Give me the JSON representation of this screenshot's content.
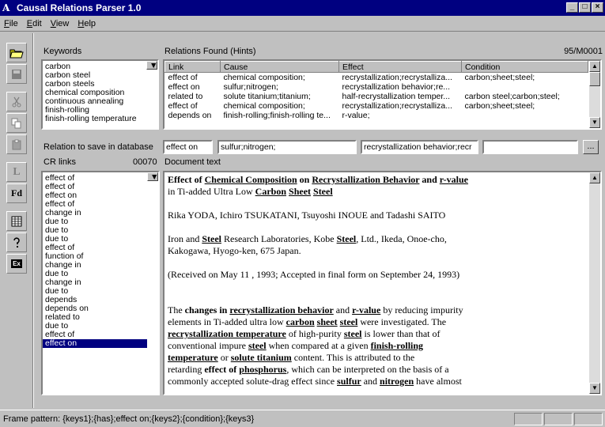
{
  "app": {
    "title": "Causal Relations Parser 1.0"
  },
  "menu": [
    {
      "pre": "",
      "u": "F",
      "post": "ile"
    },
    {
      "pre": "",
      "u": "E",
      "post": "dit"
    },
    {
      "pre": "",
      "u": "V",
      "post": "iew"
    },
    {
      "pre": "",
      "u": "H",
      "post": "elp"
    }
  ],
  "toolbar": {
    "l_label": "L",
    "fd_label": "Fd",
    "ex_label": "Ex",
    "help_label": "?"
  },
  "keywords": {
    "label": "Keywords",
    "items": [
      "carbon",
      "carbon steel",
      "carbon steels",
      "chemical composition",
      "continuous annealing",
      "finish-rolling",
      "finish-rolling temperature"
    ]
  },
  "relations": {
    "label": "Relations Found (Hints)",
    "counter": "95/M0001",
    "columns": [
      "Link",
      "Cause",
      "Effect",
      "Condition"
    ],
    "rows": [
      [
        "effect of",
        "chemical composition;",
        "recrystallization;recrystalliza...",
        "carbon;sheet;steel;"
      ],
      [
        "effect on",
        "sulfur;nitrogen;",
        "recrystallization behavior;re...",
        ""
      ],
      [
        "related to",
        "solute titanium;titanium;",
        "half-recrystallization temper...",
        "carbon steel;carbon;steel;"
      ],
      [
        "effect of",
        "chemical composition;",
        "recrystallization;recrystalliza...",
        "carbon;sheet;steel;"
      ],
      [
        "depends on",
        "finish-rolling;finish-rolling te...",
        "r-value;",
        ""
      ]
    ]
  },
  "save": {
    "label": "Relation to save in database",
    "link": "effect on",
    "cause": "sulfur;nitrogen;",
    "effect": "recrystallization behavior;recr",
    "condition": "",
    "browse": "..."
  },
  "crlinks": {
    "label": "CR links",
    "count": "00070",
    "items": [
      "effect of",
      "effect of",
      "effect on",
      "effect of",
      "change in",
      "due to",
      "due to",
      "due to",
      "effect of",
      "function of",
      "change in",
      "due to",
      "change in",
      "due to",
      "depends",
      "depends on",
      "related to",
      "due to",
      "effect of",
      "effect on"
    ],
    "selected_index": 19
  },
  "doc": {
    "label": "Document text",
    "title1": {
      "a": "Effect of ",
      "b": "Chemical Composition",
      "c": " on ",
      "d": "Recrystallization Behavior",
      "e": " and ",
      "f": "r-value"
    },
    "title2": {
      "a": "in Ti-added Ultra Low ",
      "b": "Carbon",
      "c": " ",
      "d": "Sheet",
      "e": " ",
      "f": "Steel"
    },
    "authors": "Rika YODA, Ichiro TSUKATANI, Tsuyoshi INOUE and Tadashi SAITO",
    "affil1": {
      "a": "Iron and ",
      "b": "Steel",
      "c": " Research Laboratories, Kobe ",
      "d": "Steel",
      "e": ", Ltd., Ikeda, Onoe-cho,"
    },
    "affil2": "Kakogawa, Hyogo-ken, 675 Japan.",
    "received": "(Received on May 11 , 1993; Accepted in final form on September 24, 1993)",
    "abs": [
      [
        {
          "t": "The "
        },
        {
          "t": "changes in",
          "c": "b"
        },
        {
          "t": " "
        },
        {
          "t": "recrystallization behavior",
          "c": "k"
        },
        {
          "t": " and "
        },
        {
          "t": "r-value",
          "c": "k"
        },
        {
          "t": " by reducing impurity"
        }
      ],
      [
        {
          "t": "elements in Ti-added ultra low "
        },
        {
          "t": "carbon",
          "c": "k"
        },
        {
          "t": " "
        },
        {
          "t": "sheet",
          "c": "k"
        },
        {
          "t": " "
        },
        {
          "t": "steel",
          "c": "k"
        },
        {
          "t": " were investigated. The"
        }
      ],
      [
        {
          "t": "recrystallization temperature",
          "c": "k"
        },
        {
          "t": " of high-purity "
        },
        {
          "t": "steel",
          "c": "k"
        },
        {
          "t": " is lower than that of"
        }
      ],
      [
        {
          "t": "conventional impure "
        },
        {
          "t": "steel",
          "c": "k"
        },
        {
          "t": " when compared at a given "
        },
        {
          "t": "finish-rolling",
          "c": "k"
        }
      ],
      [
        {
          "t": "temperature",
          "c": "k"
        },
        {
          "t": " or "
        },
        {
          "t": "solute titanium",
          "c": "k"
        },
        {
          "t": " content. This is attributed to the"
        }
      ],
      [
        {
          "t": "retarding "
        },
        {
          "t": "effect of",
          "c": "b"
        },
        {
          "t": " "
        },
        {
          "t": "phosphorus",
          "c": "k"
        },
        {
          "t": ", which can be interpreted on the basis of a"
        }
      ],
      [
        {
          "t": "commonly accepted solute-drag effect since "
        },
        {
          "t": "sulfur",
          "c": "k"
        },
        {
          "t": " and "
        },
        {
          "t": "nitrogen",
          "c": "k"
        },
        {
          "t": " have almost"
        }
      ]
    ]
  },
  "status": {
    "text": "Frame pattern: {keys1};{has};effect on;{keys2};{condition};{keys3}"
  },
  "colors": {
    "titlebar": "#000080",
    "selection": "#000080",
    "face": "#c0c0c0"
  }
}
